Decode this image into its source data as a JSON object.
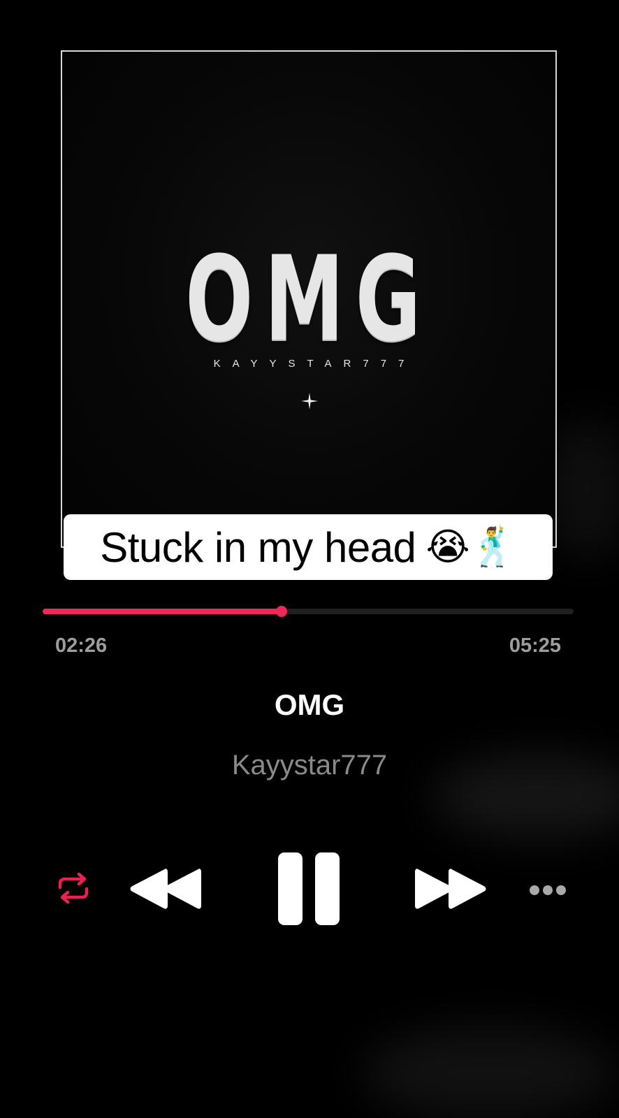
{
  "album_art": {
    "title": "OMG",
    "artist": "KAYYSTAR777"
  },
  "caption": {
    "text": "Stuck in my head",
    "emojis": "😭🕺"
  },
  "player": {
    "progress_fraction": 0.45,
    "elapsed": "02:26",
    "total": "05:25",
    "track_title": "OMG",
    "track_artist": "Kayystar777"
  },
  "controls": {
    "repeat_icon": "repeat-icon",
    "rewind_icon": "rewind-icon",
    "pause_icon": "pause-icon",
    "forward_icon": "fast-forward-icon",
    "more_icon": "more-icon"
  },
  "colors": {
    "accent": "#f0285a",
    "background": "#000000",
    "secondary_text": "#8a8a8a"
  }
}
